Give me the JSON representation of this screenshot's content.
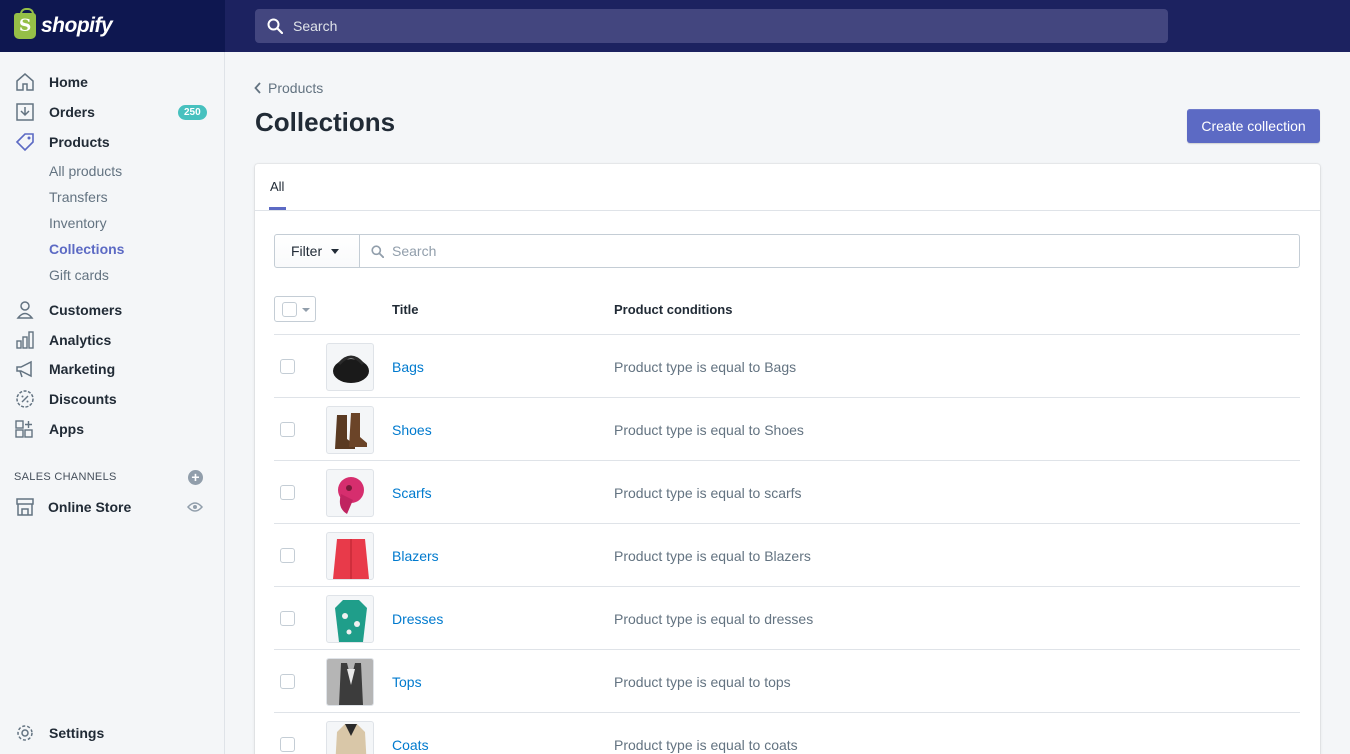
{
  "brand": {
    "logo_text": "shopify",
    "logo_glyph": "S"
  },
  "top_search": {
    "placeholder": "Search"
  },
  "sidebar": {
    "items": [
      {
        "label": "Home",
        "icon": "home-icon"
      },
      {
        "label": "Orders",
        "icon": "orders-icon",
        "badge": "250"
      },
      {
        "label": "Products",
        "icon": "tag-icon"
      },
      {
        "label": "Customers",
        "icon": "person-icon"
      },
      {
        "label": "Analytics",
        "icon": "analytics-icon"
      },
      {
        "label": "Marketing",
        "icon": "megaphone-icon"
      },
      {
        "label": "Discounts",
        "icon": "discount-icon"
      },
      {
        "label": "Apps",
        "icon": "apps-icon"
      }
    ],
    "products_sub": [
      "All products",
      "Transfers",
      "Inventory",
      "Collections",
      "Gift cards"
    ],
    "active_sub": "Collections",
    "sales_channels_title": "SALES CHANNELS",
    "online_store": "Online Store",
    "settings": "Settings"
  },
  "breadcrumb": {
    "label": "Products"
  },
  "page": {
    "title": "Collections",
    "create_button": "Create collection"
  },
  "tabs": [
    {
      "label": "All"
    }
  ],
  "filter": {
    "button_label": "Filter",
    "search_placeholder": "Search"
  },
  "table": {
    "columns": [
      "Title",
      "Product conditions"
    ],
    "rows": [
      {
        "title": "Bags",
        "condition": "Product type is equal to Bags",
        "thumb_color": "#1a1a1a"
      },
      {
        "title": "Shoes",
        "condition": "Product type is equal to Shoes",
        "thumb_color": "#5a3a22"
      },
      {
        "title": "Scarfs",
        "condition": "Product type is equal to scarfs",
        "thumb_color": "#d62e6e"
      },
      {
        "title": "Blazers",
        "condition": "Product type is equal to Blazers",
        "thumb_color": "#e83a4a"
      },
      {
        "title": "Dresses",
        "condition": "Product type is equal to dresses",
        "thumb_color": "#1f9e8a"
      },
      {
        "title": "Tops",
        "condition": "Product type is equal to tops",
        "thumb_color": "#3c3c3c"
      },
      {
        "title": "Coats",
        "condition": "Product type is equal to coats",
        "thumb_color": "#d9c7a8"
      }
    ]
  },
  "colors": {
    "topbar": "#1c2260",
    "accent": "#5c6ac4",
    "link": "#007ace",
    "badge": "#47c1bf"
  }
}
